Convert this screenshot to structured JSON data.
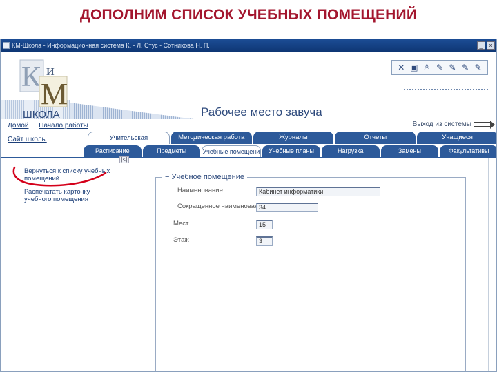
{
  "slide_title": "ДОПОЛНИМ СПИСОК УЧЕБНЫХ ПОМЕЩЕНИЙ",
  "window": {
    "title": "КМ-Школа - Информационная система  К. - Л. Стус - Сотникова Н. П.",
    "minimize": "_",
    "close": "×"
  },
  "logo": {
    "letter_k": "К",
    "letter_i": "и",
    "letter_m": "М",
    "school": "ШКОЛА"
  },
  "header": {
    "workplace": "Рабочее место завуча",
    "exit": "Выход из системы"
  },
  "toolbar": [
    "✕",
    "▣",
    "♙",
    "✎",
    "✎",
    "✎",
    "✎"
  ],
  "top_links": [
    "Домой",
    "Начало работы"
  ],
  "site_link": "Сайт школы",
  "tabs": [
    {
      "label": "Учительская",
      "active": true
    },
    {
      "label": "Методическая работа",
      "active": false
    },
    {
      "label": "Журналы",
      "active": false
    },
    {
      "label": "Отчеты",
      "active": false
    },
    {
      "label": "Учащиеся",
      "active": false
    }
  ],
  "subtabs": [
    {
      "label": "Расписание",
      "active": false
    },
    {
      "label": "Предметы",
      "active": false
    },
    {
      "label": "Учебные помещения",
      "active": true
    },
    {
      "label": "Учебные планы",
      "active": false
    },
    {
      "label": "Нагрузка",
      "active": false
    },
    {
      "label": "Замены",
      "active": false
    },
    {
      "label": "Факультативы",
      "active": false
    }
  ],
  "collapse": "|<|",
  "sidebar": {
    "link1": "Вернуться к списку учебных помещений",
    "link2": "Распечатать карточку учебного помещения"
  },
  "form": {
    "legend": "−  Учебное помещение",
    "fields": [
      {
        "label": "Наименование",
        "value": "Кабинет информатики"
      },
      {
        "label": "Сокращенное наименование",
        "value": "34"
      },
      {
        "label": "Мест",
        "value": "15"
      },
      {
        "label": "Этаж",
        "value": "3"
      }
    ]
  },
  "colors": {
    "title": "#a3162e",
    "tab": "#2d5a9a",
    "annotation": "#d4001a"
  }
}
